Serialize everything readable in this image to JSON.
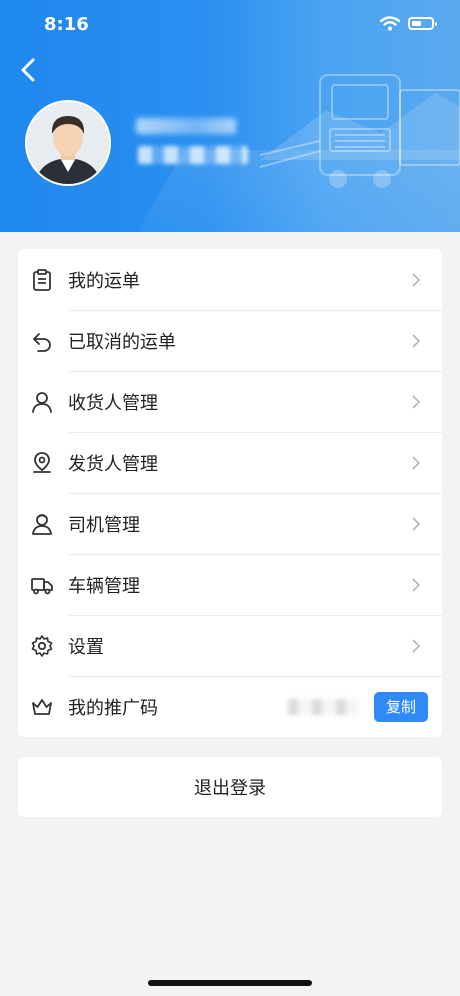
{
  "status_bar": {
    "time": "8:16"
  },
  "profile": {},
  "menu": [
    {
      "label": "我的运单",
      "icon": "clipboard-icon"
    },
    {
      "label": "已取消的运单",
      "icon": "undo-arrow-icon"
    },
    {
      "label": "收货人管理",
      "icon": "person-icon"
    },
    {
      "label": "发货人管理",
      "icon": "location-pin-icon"
    },
    {
      "label": "司机管理",
      "icon": "driver-icon"
    },
    {
      "label": "车辆管理",
      "icon": "truck-icon"
    },
    {
      "label": "设置",
      "icon": "gear-icon"
    }
  ],
  "promo": {
    "label": "我的推广码",
    "icon": "crown-icon",
    "copy_label": "复制"
  },
  "logout_label": "退出登录",
  "colors": {
    "header_blue": "#2a8ff0",
    "accent": "#2f8af5",
    "background": "#f2f3f5"
  }
}
